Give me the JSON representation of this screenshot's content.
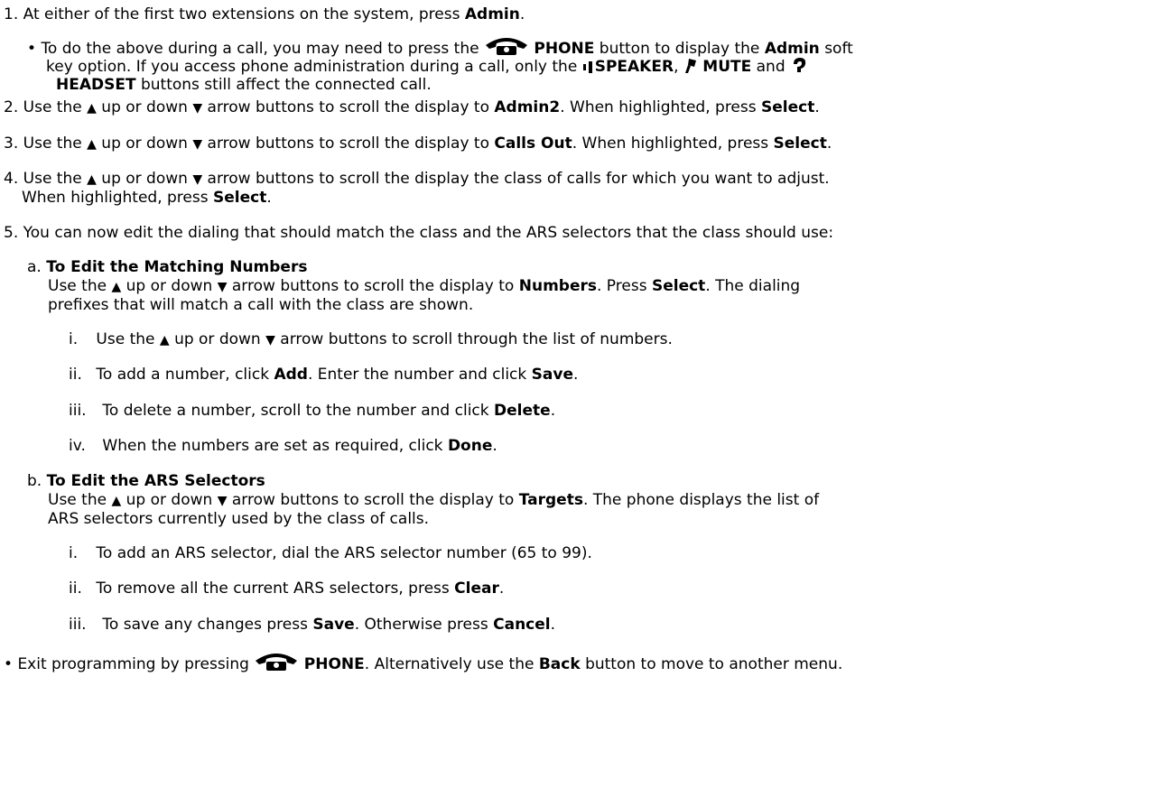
{
  "common": {
    "arrows_pre": "Use the",
    "up": "up or down",
    "arrow_buttons": "arrow buttons to scroll the display to",
    "when_highlighted_press": ". When highlighted, press",
    "select": "Select",
    "period": "."
  },
  "steps": {
    "s1": {
      "num": "1.",
      "a": "At either of the first two extensions on the system, press",
      "b": "Admin"
    },
    "s1_sub": {
      "l1a": "To do the above during a call, you may need to press the",
      "phone": "PHONE",
      "l1b": "button to display the",
      "admin": "Admin",
      "l1c": "soft",
      "l2a": "key option. If you access phone administration during a call, only the",
      "speaker": "SPEAKER",
      "mute": "MUTE",
      "and": "and",
      "headset": "HEADSET",
      "l3b": "buttons still affect the connected call."
    },
    "s2": {
      "num": "2.",
      "target": "Admin2"
    },
    "s3": {
      "num": "3.",
      "target": "Calls Out"
    },
    "s4": {
      "num": "4.",
      "l1": "arrow buttons to scroll the display the class of calls for which you want to adjust.",
      "l2a": "When highlighted, press",
      "select": "Select"
    },
    "s5": {
      "num": "5.",
      "text": "You can now edit the dialing that should match the class and the ARS selectors that the class should use:"
    }
  },
  "sub_a": {
    "letter": "a.",
    "title": "To Edit the Matching Numbers",
    "l1target": "Numbers",
    "l1b": ". Press",
    "select": "Select",
    "l1c": ". The dialing",
    "l2": "prefixes that will match a call with the class are shown.",
    "items": {
      "i": {
        "num": "i.",
        "tail": "arrow buttons to scroll through the list of numbers."
      },
      "ii": {
        "num": "ii.",
        "a": "To add a number, click",
        "add": "Add",
        "b": ". Enter the number and click",
        "save": "Save"
      },
      "iii": {
        "num": "iii.",
        "a": "To delete a number, scroll to the number and click",
        "delete": "Delete"
      },
      "iv": {
        "num": "iv.",
        "a": "When the numbers are set as required, click",
        "done": "Done"
      }
    }
  },
  "sub_b": {
    "letter": "b.",
    "title": "To Edit the ARS Selectors",
    "l1target": "Targets",
    "l1b": ". The phone displays the list of",
    "l2": "ARS selectors currently used by the class of calls.",
    "items": {
      "i": {
        "num": "i.",
        "text": "To add an ARS selector, dial the ARS selector number (65 to 99)."
      },
      "ii": {
        "num": "ii.",
        "a": "To remove all the current ARS selectors, press",
        "clear": "Clear"
      },
      "iii": {
        "num": "iii.",
        "a": "To save any changes press",
        "save": "Save",
        "b": ". Otherwise press",
        "cancel": "Cancel"
      }
    }
  },
  "exit": {
    "a": "Exit programming by pressing",
    "phone": "PHONE",
    "b": ". Alternatively use the",
    "back": "Back",
    "c": "button to move to another menu."
  },
  "icons": {
    "phone": "telephone-icon",
    "speaker": "speaker-icon",
    "mute": "microphone-icon",
    "headset": "headset-icon",
    "up": "up-arrow-icon",
    "down": "down-arrow-icon"
  },
  "colors": {
    "icon": "#000000",
    "text": "#000000",
    "background": "#ffffff"
  }
}
